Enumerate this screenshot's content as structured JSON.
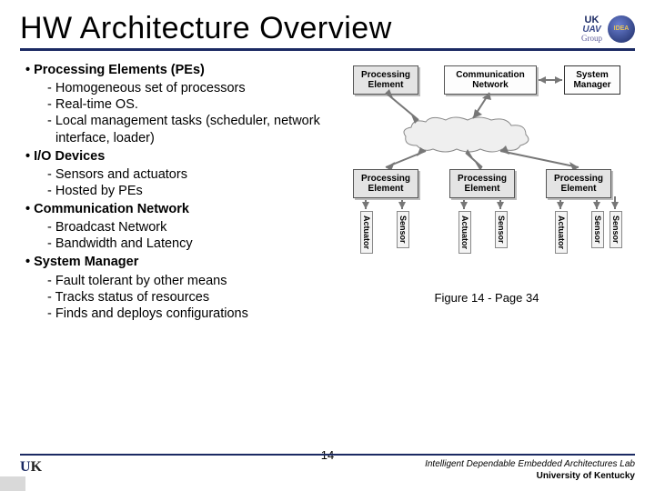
{
  "title": "HW Architecture Overview",
  "logos": {
    "uk": "UK",
    "uav": "UAV",
    "group": "Group",
    "idea": "IDEA"
  },
  "bullets": {
    "pe": {
      "heading": "Processing Elements (PEs)",
      "items": [
        "Homogeneous set of processors",
        "Real-time OS.",
        "Local management tasks (scheduler, network interface, loader)"
      ]
    },
    "io": {
      "heading": "I/O Devices",
      "items": [
        "Sensors and actuators",
        "Hosted by PEs"
      ]
    },
    "cn": {
      "heading": "Communication Network",
      "items": [
        "Broadcast Network",
        "Bandwidth and Latency"
      ]
    },
    "sm": {
      "heading": "System Manager",
      "items": [
        "Fault tolerant by other means",
        "Tracks status of resources",
        "Finds and deploys configurations"
      ]
    }
  },
  "diagram": {
    "pe_label": "Processing Element",
    "comm_label": "Communication Network",
    "sm_label": "System Manager",
    "actuator": "Actuator",
    "sensor": "Sensor",
    "caption": "Figure 14 - Page 34"
  },
  "footer": {
    "uk": "UK",
    "page": "14",
    "lab": "Intelligent Dependable Embedded Architectures Lab",
    "uni": "University of Kentucky"
  }
}
